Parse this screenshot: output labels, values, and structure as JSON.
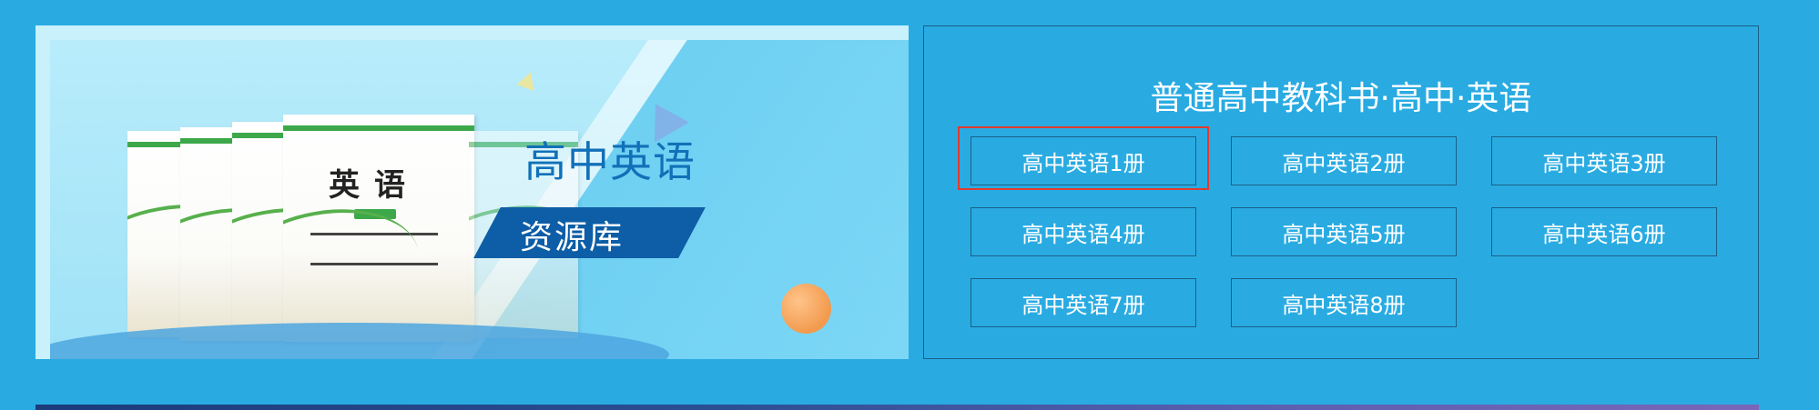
{
  "banner": {
    "heading": "高中英语",
    "tag": "资源库",
    "book_title": "英语"
  },
  "panel": {
    "title": "普通高中教科书·高中·英语",
    "volumes": [
      {
        "label": "高中英语1册",
        "selected": true
      },
      {
        "label": "高中英语2册",
        "selected": false
      },
      {
        "label": "高中英语3册",
        "selected": false
      },
      {
        "label": "高中英语4册",
        "selected": false
      },
      {
        "label": "高中英语5册",
        "selected": false
      },
      {
        "label": "高中英语6册",
        "selected": false
      },
      {
        "label": "高中英语7册",
        "selected": false
      },
      {
        "label": "高中英语8册",
        "selected": false
      }
    ]
  },
  "colors": {
    "background": "#29abe2",
    "banner_heading": "#1170b8",
    "tag_background": "#0d5ea6",
    "highlight": "#e23a2e",
    "button_border": "#1a5f86"
  }
}
